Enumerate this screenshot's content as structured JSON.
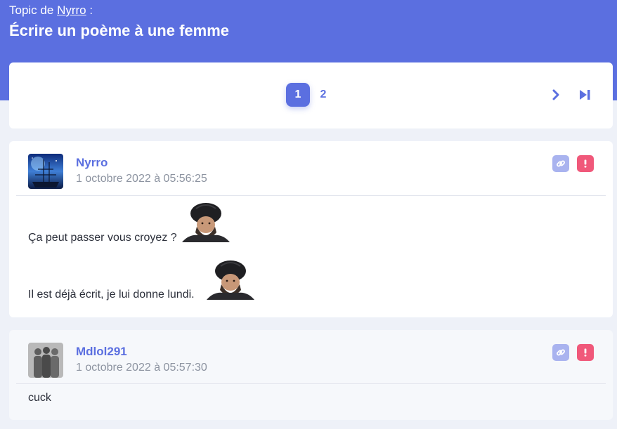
{
  "header": {
    "topic_prefix": "Topic de",
    "topic_author": "Nyrro",
    "topic_suffix": ":",
    "title": "Écrire un poème à une femme"
  },
  "pagination": {
    "pages": [
      "1",
      "2"
    ],
    "current": "1",
    "next_icon": "chevron-right-icon",
    "last_icon": "skip-to-last-icon"
  },
  "posts": [
    {
      "author": "Nyrro",
      "date": "1 octobre 2022 à 05:56:25",
      "avatar": "night-sky-ship-avatar",
      "lines": [
        "Ça peut passer vous croyez ?",
        "Il est déjà écrit, je lui donne lundi."
      ],
      "sticker": "bearded-man-turban-sticker"
    },
    {
      "author": "Mdlol291",
      "date": "1 octobre 2022 à 05:57:30",
      "avatar": "three-silhouettes-avatar",
      "lines": [
        "cuck"
      ]
    }
  ],
  "actions": {
    "link_icon": "link-icon",
    "report_icon": "exclamation-icon"
  },
  "colors": {
    "accent": "#5b6fe0",
    "report": "#f0587a",
    "link_bg": "#a9b3ef"
  }
}
